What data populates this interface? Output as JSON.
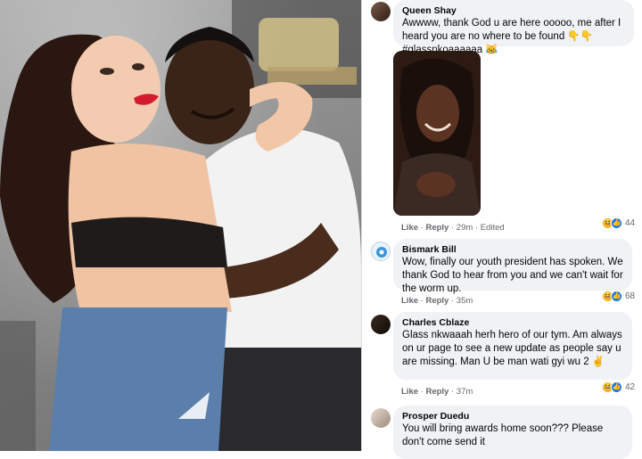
{
  "post_image": {
    "description_icon": "photo-couple"
  },
  "comments": [
    {
      "author": "Queen Shay",
      "text": "Awwww, thank God u are here ooooo, me after I heard you are no where to be found 👇👇 #glassnkoaaaaaa 😹",
      "like": "Like",
      "reply": "Reply",
      "time": "29m",
      "edited": "Edited",
      "reaction_count": "44"
    },
    {
      "author": "Bismark Bill",
      "text": "Wow, finally our youth president has spoken. We thank God to hear from you and we can't wait for the worm up.",
      "like": "Like",
      "reply": "Reply",
      "time": "35m",
      "reaction_count": "68"
    },
    {
      "author": "Charles Cblaze",
      "text": "Glass nkwaaah herh hero of our tym. Am always on ur page to see a new update as people say u are missing. Man U be man wati gyi wu 2 ✌",
      "like": "Like",
      "reply": "Reply",
      "time": "37m",
      "reaction_count": "42"
    },
    {
      "author": "Prosper Duedu",
      "text": "You will bring awards home soon??? Please don't come send it"
    }
  ],
  "colors": {
    "bubble": "#f0f2f5",
    "arrow": "#e01b1b",
    "link_meta": "#65676b",
    "like_blue": "#1877f2",
    "haha_yellow": "#f7b125"
  }
}
